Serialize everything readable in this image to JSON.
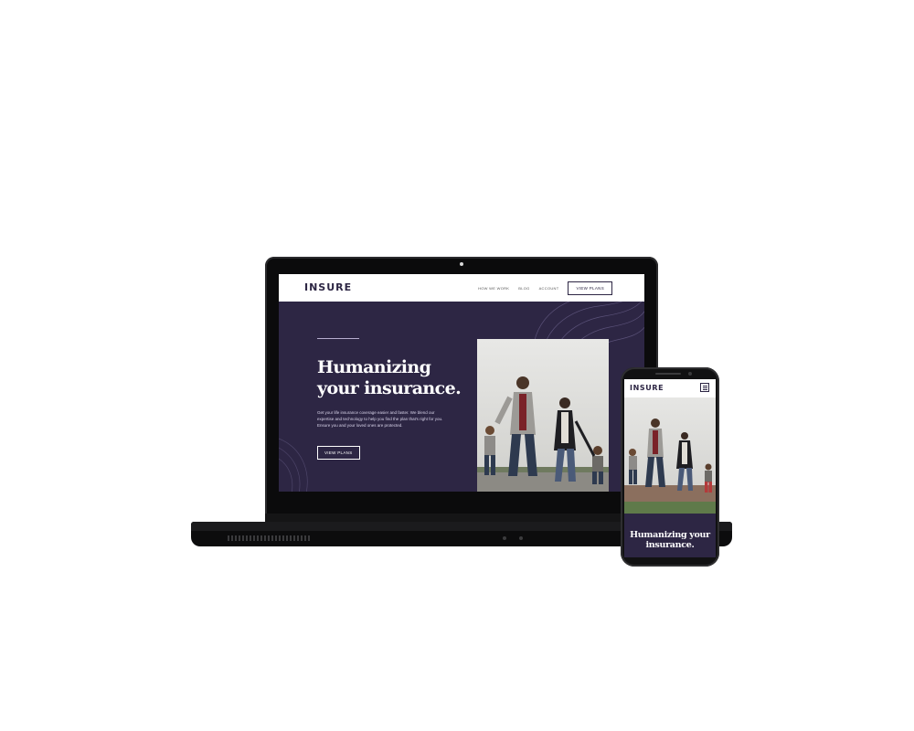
{
  "site": {
    "logo": "INSURE",
    "nav": {
      "links": [
        "HOW WE WORK",
        "BLOG",
        "ACCOUNT"
      ],
      "cta": "VIEW PLANS"
    },
    "hero": {
      "title": "Humanizing your insurance.",
      "body": "Get your life insurance coverage easier and faster. We blend our expertise and technology to help you find the plan that's right for you. Ensure you and your loved ones are protected.",
      "cta": "VIEW PLANS"
    }
  },
  "phone": {
    "logo": "INSURE",
    "menu_icon": "hamburger-menu-icon",
    "hero_title": "Humanizing your insurance."
  },
  "colors": {
    "brand_dark": "#2d2644",
    "accent_light": "#b7aecf",
    "white": "#ffffff",
    "device_frame": "#0b0b0c"
  }
}
